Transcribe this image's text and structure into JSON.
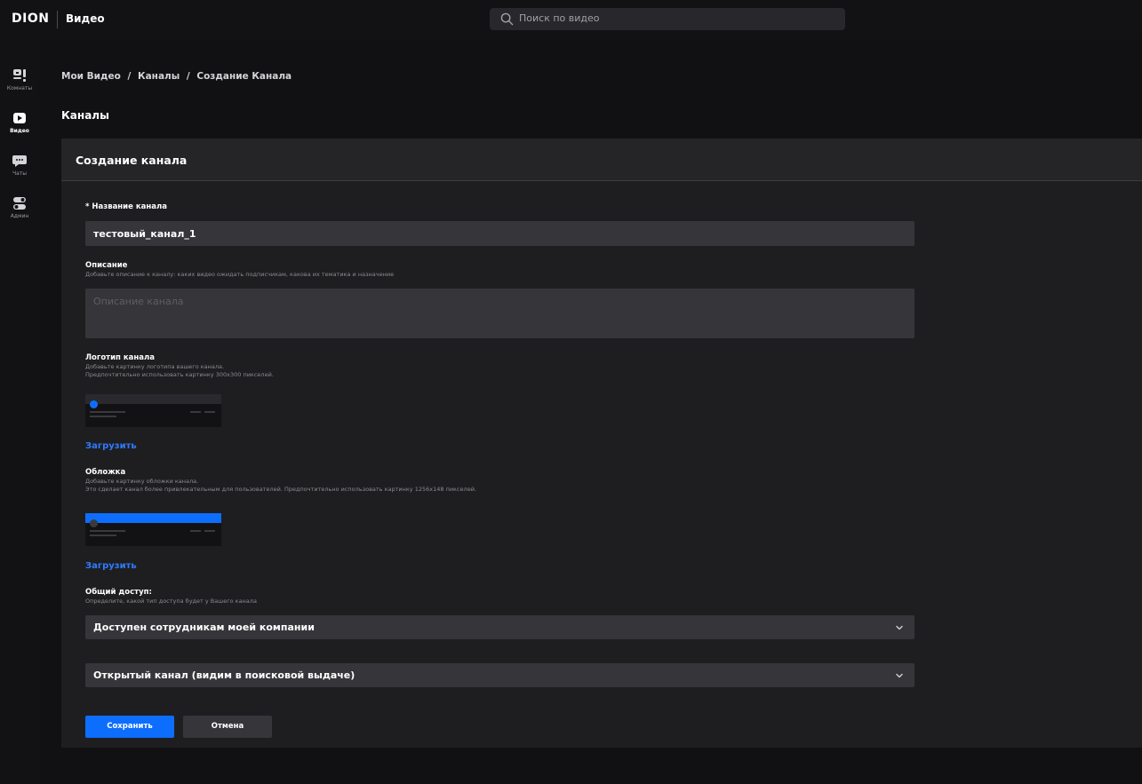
{
  "header": {
    "logo": "DION",
    "app_name": "Видео",
    "search_placeholder": "Поиск по видео"
  },
  "sidebar": {
    "items": [
      {
        "label": "Комнаты",
        "icon": "rooms-icon"
      },
      {
        "label": "Видео",
        "icon": "video-icon",
        "active": true
      },
      {
        "label": "Чаты",
        "icon": "chat-icon"
      },
      {
        "label": "Админ",
        "icon": "admin-icon"
      }
    ]
  },
  "breadcrumb": {
    "items": [
      "Мои Видео",
      "Каналы",
      "Создание Канала"
    ],
    "separator": "/"
  },
  "section_title": "Каналы",
  "form": {
    "title": "Создание канала",
    "name_label": "* Название канала",
    "name_value": "тестовый_канал_1",
    "desc_label": "Описание",
    "desc_hint": "Добавьте описание к каналу: каких видео ожидать подписчикам, какова их тематика и назначение",
    "desc_placeholder": "Описание канала",
    "logo_label": "Логотип канала",
    "logo_hint_1": "Добавьте картинку логотипа вашего канала.",
    "logo_hint_2": "Предпочтительно использовать картинку 300x300 пикселей.",
    "logo_upload": "Загрузить",
    "cover_label": "Обложка",
    "cover_hint_1": "Добавьте картинку обложки канала.",
    "cover_hint_2": "Это сделает канал более привлекательным для пользователей. Предпочтительно использовать картинку 1256x148 пикселей.",
    "cover_upload": "Загрузить",
    "access_label": "Общий доступ:",
    "access_hint": "Определите, какой тип доступа будет у Вашего канала",
    "access_value": "Доступен сотрудникам моей компании",
    "visibility_value": "Открытый канал (видим в поисковой выдаче)",
    "save_label": "Сохранить",
    "cancel_label": "Отмена"
  },
  "colors": {
    "accent": "#0d6efd",
    "link": "#2f7bff",
    "background": "#111113",
    "panel": "#1e1e21",
    "input": "#36363a"
  }
}
